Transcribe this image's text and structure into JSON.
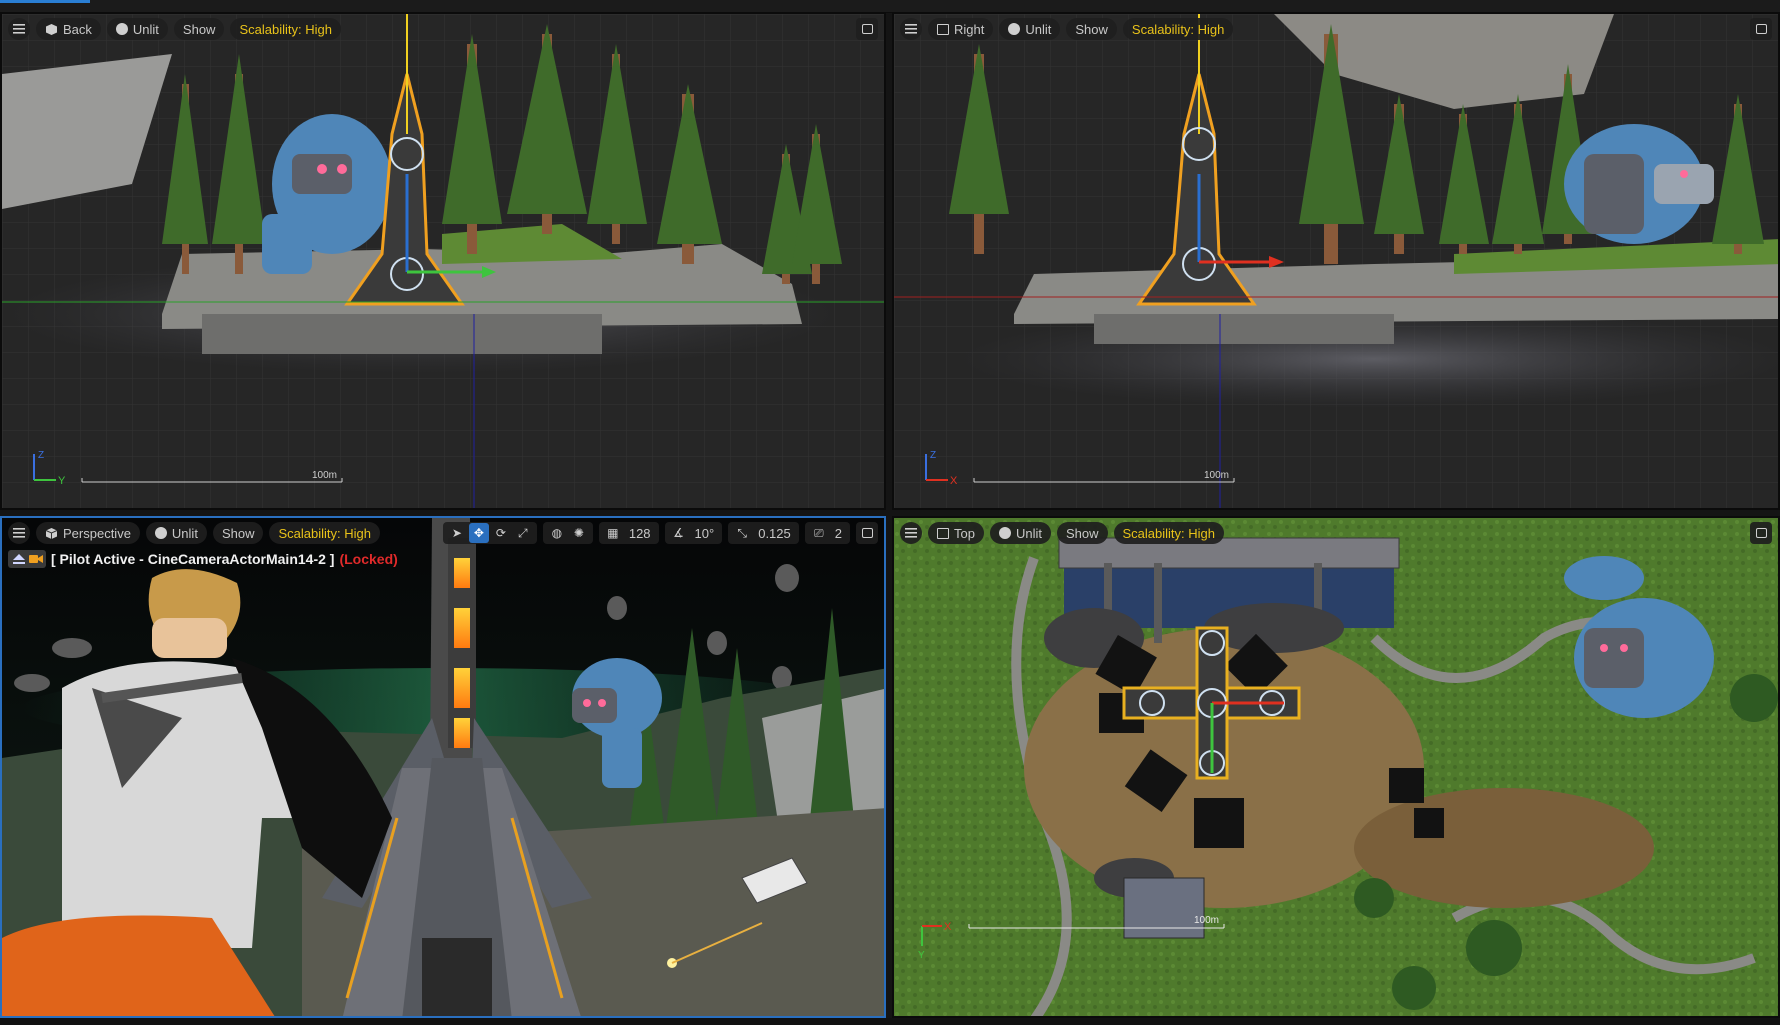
{
  "viewports": {
    "back": {
      "view_label": "Back",
      "lighting_label": "Unlit",
      "show_label": "Show",
      "scalability_label": "Scalability: High",
      "scale_label": "100m",
      "axis_h_label": "Y",
      "axis_v_label": "Z"
    },
    "right": {
      "view_label": "Right",
      "lighting_label": "Unlit",
      "show_label": "Show",
      "scalability_label": "Scalability: High",
      "scale_label": "100m",
      "axis_h_label": "X",
      "axis_v_label": "Z"
    },
    "perspective": {
      "view_label": "Perspective",
      "lighting_label": "Unlit",
      "show_label": "Show",
      "scalability_label": "Scalability: High",
      "grid_snap_value": "128",
      "rotation_snap_value": "10°",
      "scale_snap_value": "0.125",
      "camera_speed_value": "2",
      "pilot_text": "[ Pilot Active - CineCameraActorMain14-2 ]",
      "pilot_locked_text": "(Locked)"
    },
    "top": {
      "view_label": "Top",
      "lighting_label": "Unlit",
      "show_label": "Show",
      "scalability_label": "Scalability: High",
      "scale_label": "100m",
      "axis_h_label": "X",
      "axis_v_label": "Y"
    }
  },
  "icons": {
    "menu": "hamburger-menu-icon",
    "lit": "lighting-mode-icon",
    "maximize": "maximize-viewport-icon",
    "perspective": "perspective-cube-icon",
    "ortho": "orthographic-view-icon"
  },
  "colors": {
    "scalability_text": "#e8c21a",
    "locked_text": "#e02a2a",
    "active_border": "#2a6fbf",
    "grass": "#4f7a2c",
    "pine": "#3f6b2a",
    "robot_blue": "#4f86b8",
    "tower_orange": "#f0a020"
  }
}
